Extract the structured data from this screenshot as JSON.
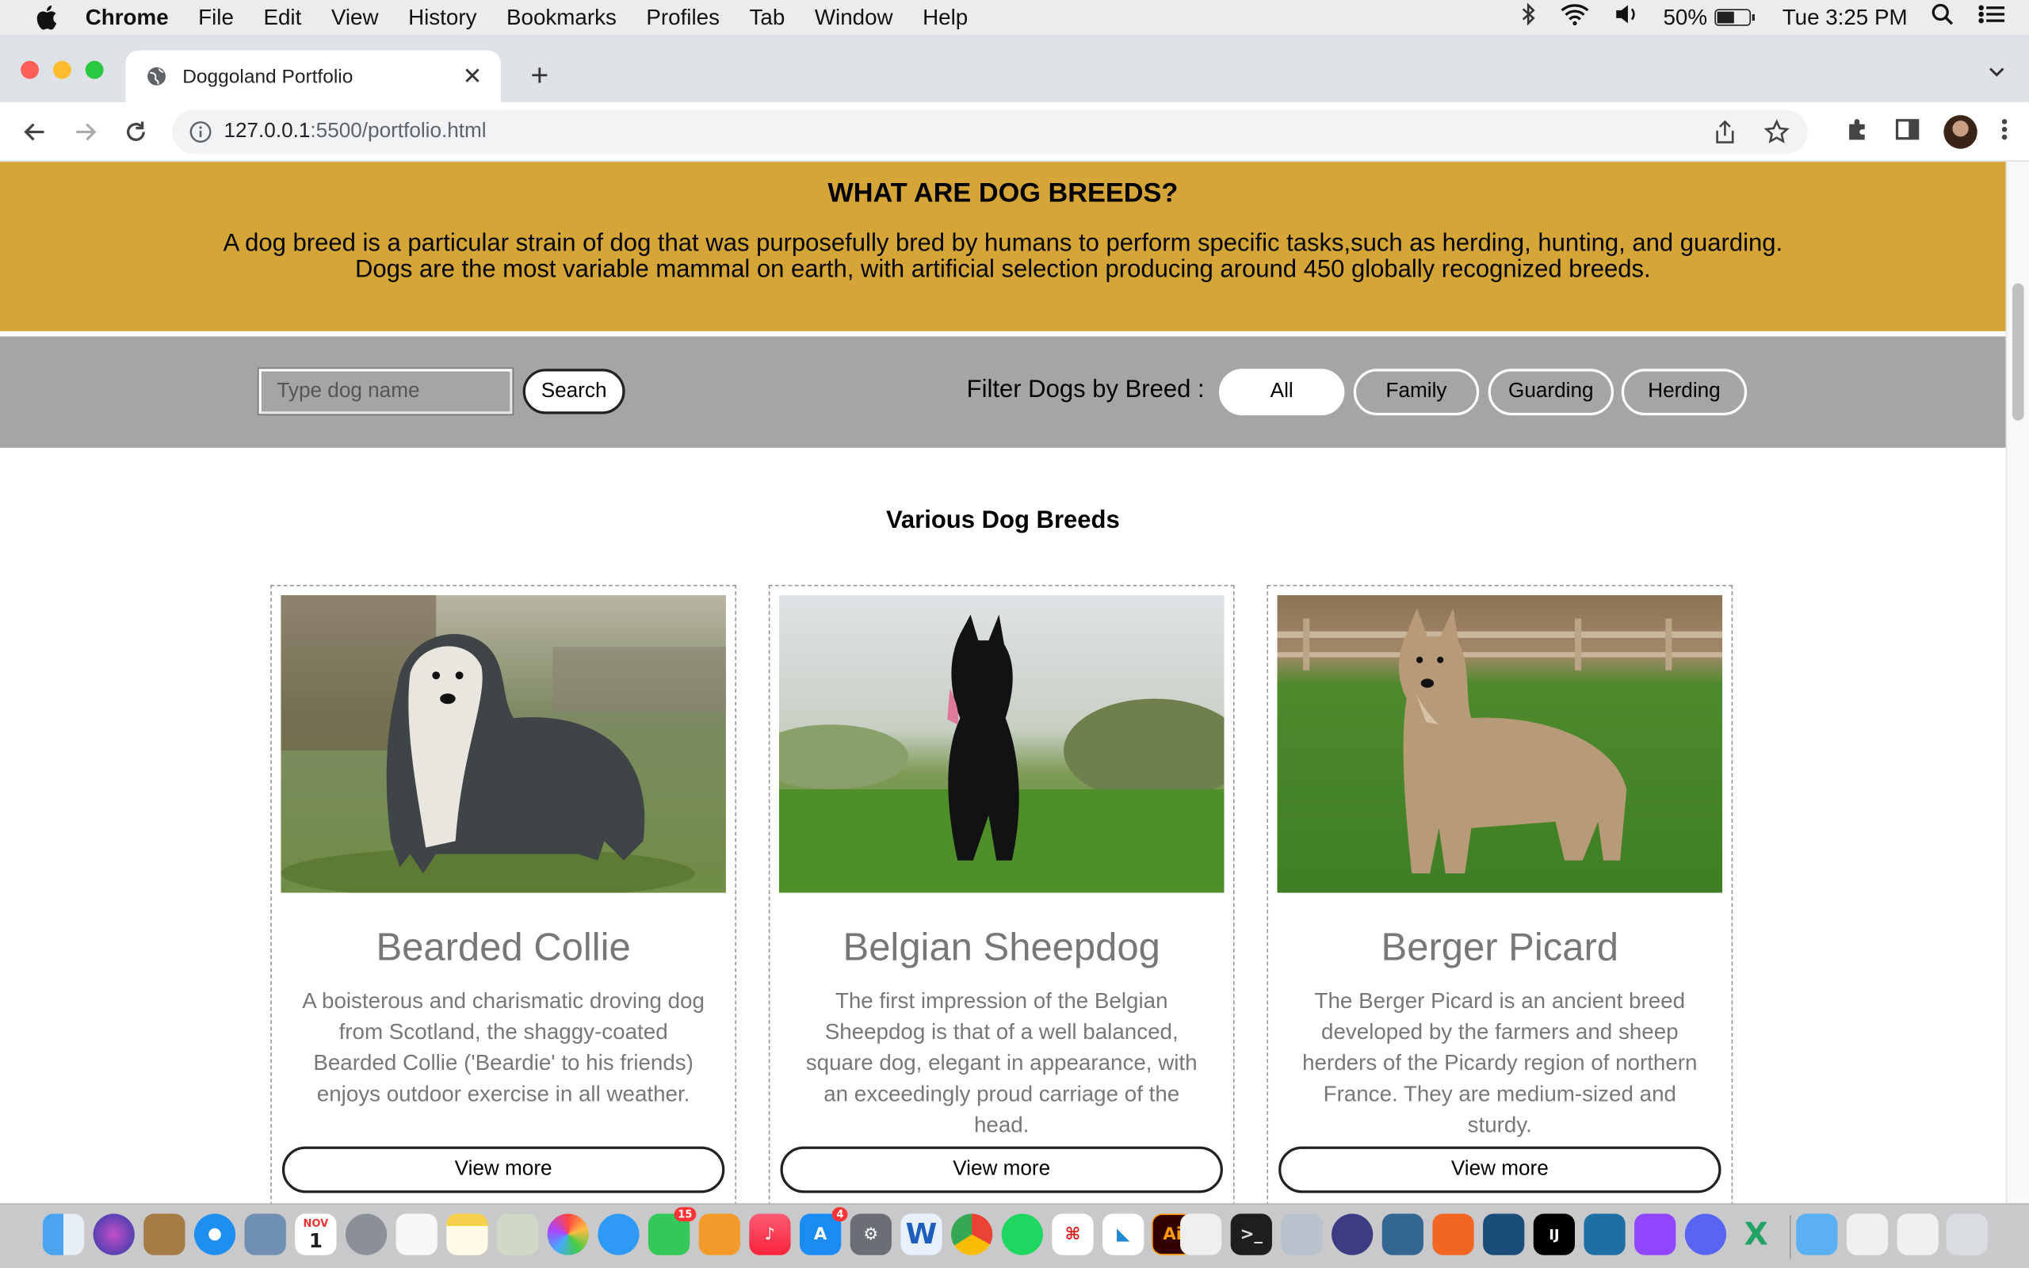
{
  "menubar": {
    "app": "Chrome",
    "items": [
      "File",
      "Edit",
      "View",
      "History",
      "Bookmarks",
      "Profiles",
      "Tab",
      "Window",
      "Help"
    ],
    "battery": "50%",
    "clock": "Tue 3:25 PM"
  },
  "tab": {
    "title": "Doggoland Portfolio"
  },
  "address": {
    "host": "127.0.0.1",
    "path": ":5500/portfolio.html"
  },
  "hero": {
    "title": "WHAT ARE DOG BREEDS?",
    "line1": "A dog breed is a particular strain of dog that was purposefully bred by humans to perform specific tasks,such as herding, hunting, and guarding.",
    "line2": "Dogs are the most variable mammal on earth, with artificial selection producing around 450 globally recognized breeds."
  },
  "filter": {
    "search_placeholder": "Type dog name",
    "search_button": "Search",
    "label": "Filter Dogs by Breed :",
    "chips": [
      "All",
      "Family",
      "Guarding",
      "Herding"
    ],
    "active_chip": "All"
  },
  "section_title": "Various Dog Breeds",
  "cards": [
    {
      "name": "Bearded Collie",
      "description": "A boisterous and charismatic droving dog from Scotland, the shaggy-coated Bearded Collie ('Beardie'  to his friends) enjoys outdoor exercise in all weather.",
      "button": "View more"
    },
    {
      "name": "Belgian Sheepdog",
      "description": "The first impression of the Belgian Sheepdog is that of a well balanced, square dog, elegant in appearance, with an exceedingly proud carriage of the head.",
      "button": "View more"
    },
    {
      "name": "Berger Picard",
      "description": "The Berger Picard is an ancient breed developed by the farmers and sheep herders of the Picardy region of northern France. They are medium-sized and sturdy.",
      "button": "View more"
    }
  ],
  "dock": {
    "calendar_day": "1",
    "calendar_month": "NOV",
    "messages_badge": "15",
    "appstore_badge": "4",
    "word_letter": "W",
    "illustrator_label": "Ai"
  },
  "colors": {
    "hero_bg": "#d5a637",
    "filter_bg": "#a5a5a5",
    "card_text": "#777777"
  }
}
